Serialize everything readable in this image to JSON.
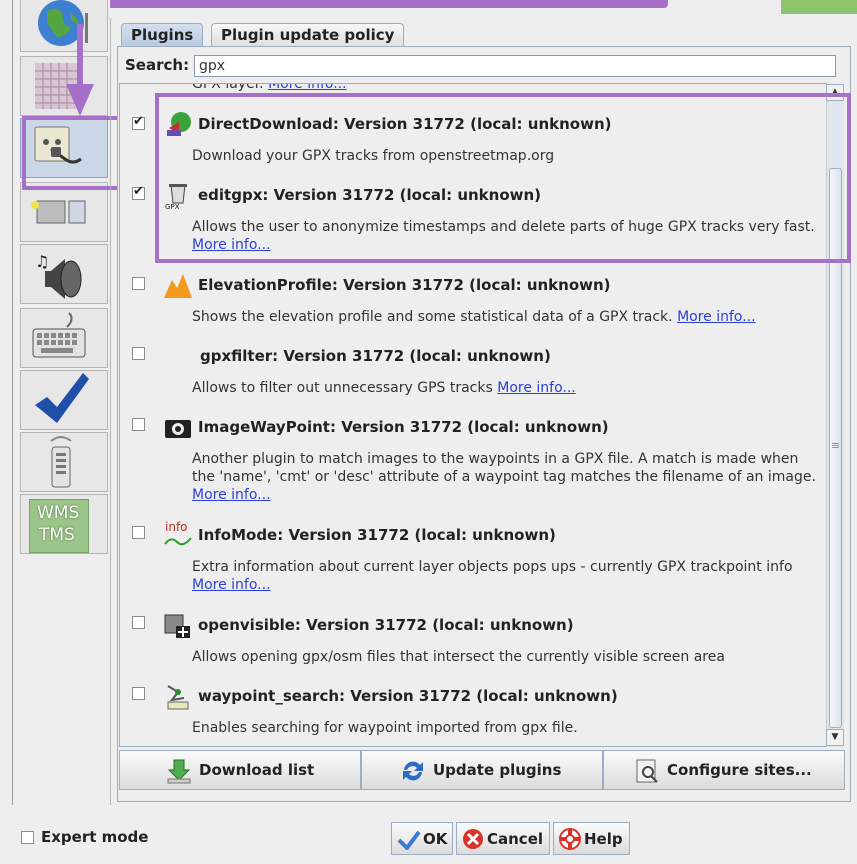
{
  "tabs": {
    "plugins": "Plugins",
    "update_policy": "Plugin update policy"
  },
  "search": {
    "label": "Search:",
    "value": "gpx"
  },
  "partial_row": {
    "text": "GPX layer.",
    "link": "More info..."
  },
  "plugins": [
    {
      "title": "DirectDownload: Version 31772 (local: unknown)",
      "checked": true,
      "desc": "Download your GPX tracks from openstreetmap.org",
      "link": ""
    },
    {
      "title": "editgpx: Version 31772 (local: unknown)",
      "checked": true,
      "desc": "Allows the user to anonymize timestamps and delete parts of huge GPX tracks very fast.",
      "link": "More info..."
    },
    {
      "title": "ElevationProfile: Version 31772 (local: unknown)",
      "checked": false,
      "desc": "Shows the elevation profile and some statistical data of a GPX track.",
      "link": "More info..."
    },
    {
      "title": "gpxfilter: Version 31772 (local: unknown)",
      "checked": false,
      "desc": "Allows to filter out unnecessary GPS tracks",
      "link": "More info..."
    },
    {
      "title": "ImageWayPoint: Version 31772 (local: unknown)",
      "checked": false,
      "desc": "Another plugin to match images to the waypoints in a GPX file. A match is made when the 'name', 'cmt' or 'desc' attribute of a waypoint tag matches the filename of an image.",
      "link": "More info..."
    },
    {
      "title": "InfoMode: Version 31772 (local: unknown)",
      "checked": false,
      "desc": "Extra information about current layer objects pops ups - currently GPX trackpoint info",
      "link": "More info..."
    },
    {
      "title": "openvisible: Version 31772 (local: unknown)",
      "checked": false,
      "desc": "Allows opening gpx/osm files that intersect the currently visible screen area",
      "link": ""
    },
    {
      "title": "waypoint_search: Version 31772 (local: unknown)",
      "checked": false,
      "desc": "Enables searching for waypoint imported from gpx file.",
      "link": ""
    }
  ],
  "infomode_icon_text": "info",
  "sidebar_wms_text": [
    "WMS",
    "TMS"
  ],
  "actions": {
    "download": "Download list",
    "update": "Update plugins",
    "configure": "Configure sites..."
  },
  "footer": {
    "expert_mode": "Expert mode",
    "ok": "OK",
    "cancel": "Cancel",
    "help": "Help"
  },
  "colors": {
    "highlight": "#a770c8",
    "link": "#2a3fd8",
    "selection": "#cbd6e6"
  }
}
